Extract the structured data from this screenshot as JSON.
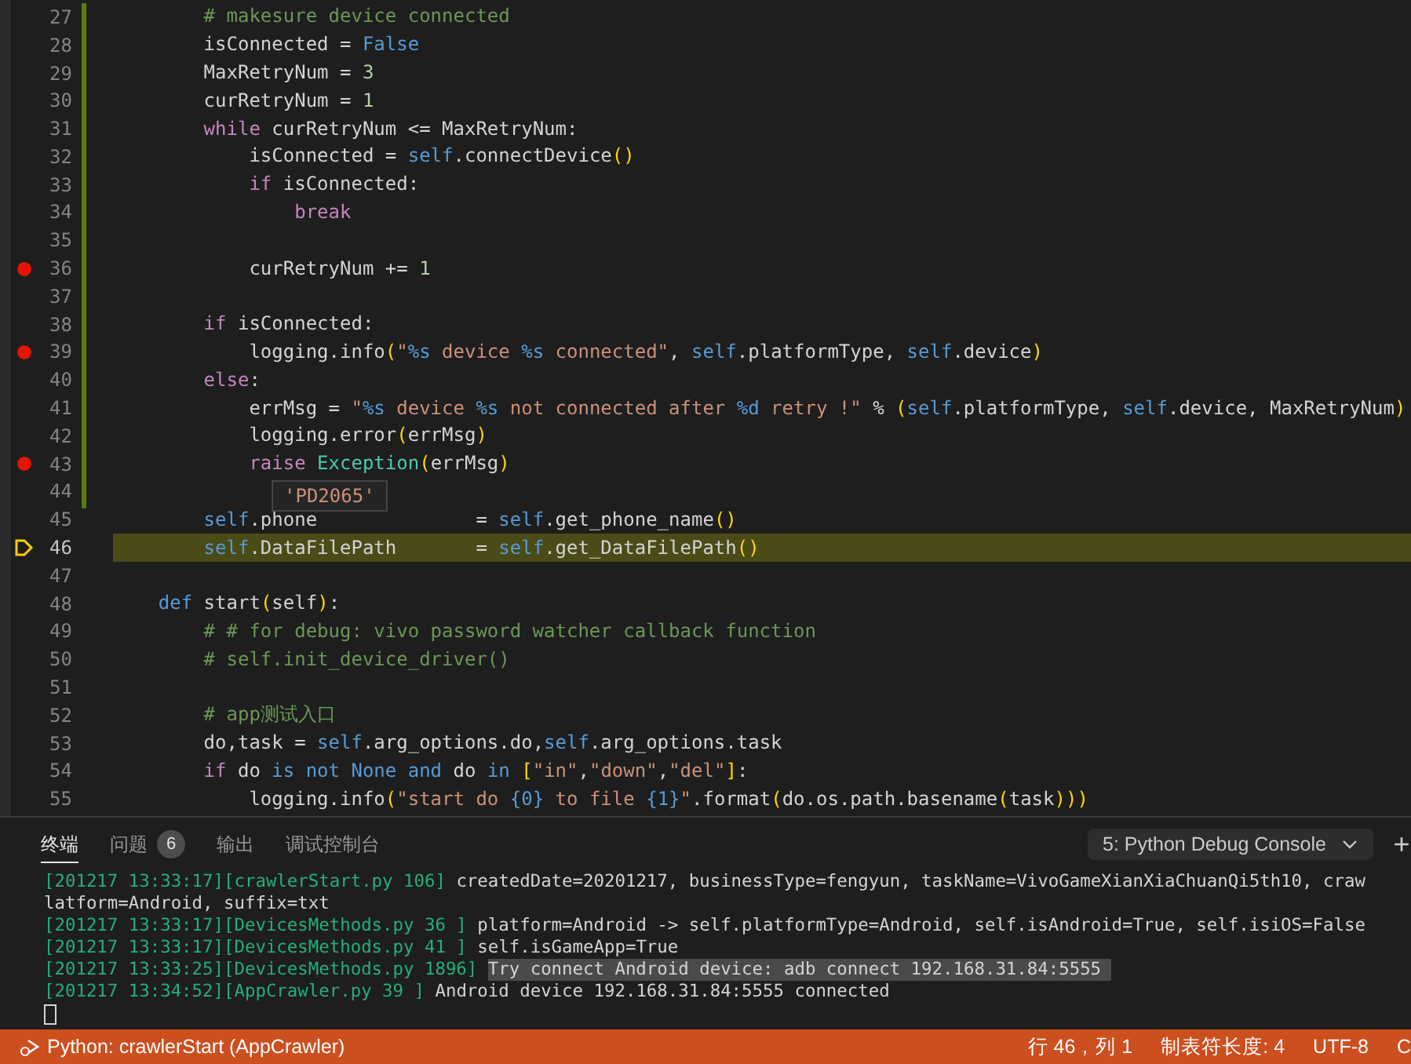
{
  "editor": {
    "lines": [
      {
        "number": "27",
        "breakpoint": false,
        "current": false,
        "tokens": [
          {
            "kind": "comment",
            "text": "        # makesure device connected"
          }
        ]
      },
      {
        "number": "28",
        "breakpoint": false,
        "current": false,
        "tokens": [
          {
            "kind": "plain",
            "text": "        isConnected = "
          },
          {
            "kind": "builtin",
            "text": "False"
          }
        ]
      },
      {
        "number": "29",
        "breakpoint": false,
        "current": false,
        "tokens": [
          {
            "kind": "plain",
            "text": "        MaxRetryNum = "
          },
          {
            "kind": "number",
            "text": "3"
          }
        ]
      },
      {
        "number": "30",
        "breakpoint": false,
        "current": false,
        "tokens": [
          {
            "kind": "plain",
            "text": "        curRetryNum = "
          },
          {
            "kind": "number",
            "text": "1"
          }
        ]
      },
      {
        "number": "31",
        "breakpoint": false,
        "current": false,
        "tokens": [
          {
            "kind": "keyword",
            "text": "        while"
          },
          {
            "kind": "plain",
            "text": " curRetryNum <= MaxRetryNum:"
          }
        ]
      },
      {
        "number": "32",
        "breakpoint": false,
        "current": false,
        "tokens": [
          {
            "kind": "plain",
            "text": "            isConnected = "
          },
          {
            "kind": "builtin",
            "text": "self"
          },
          {
            "kind": "plain",
            "text": ".connectDevice"
          },
          {
            "kind": "bracket",
            "text": "()"
          }
        ]
      },
      {
        "number": "33",
        "breakpoint": false,
        "current": false,
        "tokens": [
          {
            "kind": "keyword",
            "text": "            if"
          },
          {
            "kind": "plain",
            "text": " isConnected:"
          }
        ]
      },
      {
        "number": "34",
        "breakpoint": false,
        "current": false,
        "tokens": [
          {
            "kind": "keyword",
            "text": "                break"
          }
        ]
      },
      {
        "number": "35",
        "breakpoint": false,
        "current": false
      },
      {
        "number": "36",
        "breakpoint": true,
        "current": false,
        "tokens": [
          {
            "kind": "plain",
            "text": "            curRetryNum += "
          },
          {
            "kind": "number",
            "text": "1"
          }
        ]
      },
      {
        "number": "37",
        "breakpoint": false,
        "current": false
      },
      {
        "number": "38",
        "breakpoint": false,
        "current": false,
        "tokens": [
          {
            "kind": "keyword",
            "text": "        if"
          },
          {
            "kind": "plain",
            "text": " isConnected:"
          }
        ]
      },
      {
        "number": "39",
        "breakpoint": true,
        "current": false,
        "tokens": [
          {
            "kind": "plain",
            "text": "            logging.info"
          },
          {
            "kind": "bracket",
            "text": "("
          },
          {
            "kind": "string",
            "text": "\""
          },
          {
            "kind": "format",
            "text": "%s"
          },
          {
            "kind": "string",
            "text": " device "
          },
          {
            "kind": "format",
            "text": "%s"
          },
          {
            "kind": "string",
            "text": " connected\""
          },
          {
            "kind": "plain",
            "text": ", "
          },
          {
            "kind": "builtin",
            "text": "self"
          },
          {
            "kind": "plain",
            "text": ".platformType, "
          },
          {
            "kind": "builtin",
            "text": "self"
          },
          {
            "kind": "plain",
            "text": ".device"
          },
          {
            "kind": "bracket",
            "text": ")"
          }
        ]
      },
      {
        "number": "40",
        "breakpoint": false,
        "current": false,
        "tokens": [
          {
            "kind": "keyword",
            "text": "        else"
          },
          {
            "kind": "plain",
            "text": ":"
          }
        ]
      },
      {
        "number": "41",
        "breakpoint": false,
        "current": false,
        "tokens": [
          {
            "kind": "plain",
            "text": "            errMsg = "
          },
          {
            "kind": "string",
            "text": "\""
          },
          {
            "kind": "format",
            "text": "%s"
          },
          {
            "kind": "string",
            "text": " device "
          },
          {
            "kind": "format",
            "text": "%s"
          },
          {
            "kind": "string",
            "text": " not connected after "
          },
          {
            "kind": "format",
            "text": "%d"
          },
          {
            "kind": "string",
            "text": " retry !\""
          },
          {
            "kind": "plain",
            "text": " % "
          },
          {
            "kind": "bracket",
            "text": "("
          },
          {
            "kind": "builtin",
            "text": "self"
          },
          {
            "kind": "plain",
            "text": ".platformType, "
          },
          {
            "kind": "builtin",
            "text": "self"
          },
          {
            "kind": "plain",
            "text": ".device, MaxRetryNum"
          },
          {
            "kind": "bracket",
            "text": ")"
          }
        ]
      },
      {
        "number": "42",
        "breakpoint": false,
        "current": false,
        "tokens": [
          {
            "kind": "plain",
            "text": "            logging.error"
          },
          {
            "kind": "bracket",
            "text": "("
          },
          {
            "kind": "plain",
            "text": "errMsg"
          },
          {
            "kind": "bracket",
            "text": ")"
          }
        ]
      },
      {
        "number": "43",
        "breakpoint": true,
        "current": false,
        "tokens": [
          {
            "kind": "keyword",
            "text": "            raise"
          },
          {
            "kind": "type",
            "text": " Exception"
          },
          {
            "kind": "bracket",
            "text": "("
          },
          {
            "kind": "plain",
            "text": "errMsg"
          },
          {
            "kind": "bracket",
            "text": ")"
          }
        ]
      },
      {
        "number": "44",
        "breakpoint": false,
        "current": false
      },
      {
        "number": "45",
        "breakpoint": false,
        "current": false,
        "tokens": [
          {
            "kind": "builtin",
            "text": "        self"
          },
          {
            "kind": "plain",
            "text": ".phone              = "
          },
          {
            "kind": "builtin",
            "text": "self"
          },
          {
            "kind": "plain",
            "text": ".get_phone_name"
          },
          {
            "kind": "bracket",
            "text": "()"
          }
        ]
      },
      {
        "number": "46",
        "breakpoint": false,
        "current": true,
        "tokens": [
          {
            "kind": "builtin",
            "text": "        self"
          },
          {
            "kind": "plain",
            "text": ".DataFilePath       = "
          },
          {
            "kind": "builtin",
            "text": "self"
          },
          {
            "kind": "plain",
            "text": ".get_DataFilePath"
          },
          {
            "kind": "bracket",
            "text": "()"
          }
        ]
      },
      {
        "number": "47",
        "breakpoint": false,
        "current": false
      },
      {
        "number": "48",
        "breakpoint": false,
        "current": false,
        "tokens": [
          {
            "kind": "builtin",
            "text": "    def"
          },
          {
            "kind": "plain",
            "text": " start"
          },
          {
            "kind": "bracket",
            "text": "("
          },
          {
            "kind": "plain",
            "text": "self"
          },
          {
            "kind": "bracket",
            "text": ")"
          },
          {
            "kind": "plain",
            "text": ":"
          }
        ]
      },
      {
        "number": "49",
        "breakpoint": false,
        "current": false,
        "tokens": [
          {
            "kind": "comment",
            "text": "        # # for debug: vivo password watcher callback function"
          }
        ]
      },
      {
        "number": "50",
        "breakpoint": false,
        "current": false,
        "tokens": [
          {
            "kind": "comment",
            "text": "        # self.init_device_driver()"
          }
        ]
      },
      {
        "number": "51",
        "breakpoint": false,
        "current": false
      },
      {
        "number": "52",
        "breakpoint": false,
        "current": false,
        "tokens": [
          {
            "kind": "comment",
            "text": "        # app测试入口"
          }
        ]
      },
      {
        "number": "53",
        "breakpoint": false,
        "current": false,
        "tokens": [
          {
            "kind": "plain",
            "text": "        do,task = "
          },
          {
            "kind": "builtin",
            "text": "self"
          },
          {
            "kind": "plain",
            "text": ".arg_options.do,"
          },
          {
            "kind": "builtin",
            "text": "self"
          },
          {
            "kind": "plain",
            "text": ".arg_options.task"
          }
        ]
      },
      {
        "number": "54",
        "breakpoint": false,
        "current": false,
        "tokens": [
          {
            "kind": "keyword",
            "text": "        if"
          },
          {
            "kind": "plain",
            "text": " do "
          },
          {
            "kind": "builtin",
            "text": "is not None and"
          },
          {
            "kind": "plain",
            "text": " do "
          },
          {
            "kind": "builtin",
            "text": "in"
          },
          {
            "kind": "bracket",
            "text": " ["
          },
          {
            "kind": "string",
            "text": "\"in\""
          },
          {
            "kind": "plain",
            "text": ","
          },
          {
            "kind": "string",
            "text": "\"down\""
          },
          {
            "kind": "plain",
            "text": ","
          },
          {
            "kind": "string",
            "text": "\"del\""
          },
          {
            "kind": "bracket",
            "text": "]"
          },
          {
            "kind": "plain",
            "text": ":"
          }
        ]
      },
      {
        "number": "55",
        "breakpoint": false,
        "current": false,
        "tokens": [
          {
            "kind": "plain",
            "text": "            logging.info"
          },
          {
            "kind": "bracket",
            "text": "("
          },
          {
            "kind": "string",
            "text": "\"start do "
          },
          {
            "kind": "format",
            "text": "{0}"
          },
          {
            "kind": "string",
            "text": " to file "
          },
          {
            "kind": "format",
            "text": "{1}"
          },
          {
            "kind": "string",
            "text": "\""
          },
          {
            "kind": "plain",
            "text": ".format"
          },
          {
            "kind": "bracket",
            "text": "("
          },
          {
            "kind": "plain",
            "text": "do.os.path.basename"
          },
          {
            "kind": "bracket",
            "text": "("
          },
          {
            "kind": "plain",
            "text": "task"
          },
          {
            "kind": "bracket",
            "text": ")))"
          }
        ]
      }
    ],
    "hover_value": "'PD2065'"
  },
  "panel": {
    "tabs": [
      {
        "label": "终端",
        "selected": true
      },
      {
        "label": "问题",
        "selected": false,
        "badge": "6"
      },
      {
        "label": "输出",
        "selected": false
      },
      {
        "label": "调试控制台",
        "selected": false
      }
    ],
    "terminal_selector": "5: Python Debug Console",
    "add_button": "+",
    "lines": [
      {
        "prefix": "[201217 13:33:17][crawlerStart.py 106]",
        "text": " createdDate=20201217, businessType=fengyun, taskName=VivoGameXianXiaChuanQi5th10, craw"
      },
      {
        "text": "latform=Android, suffix=txt"
      },
      {
        "prefix": "[201217 13:33:17][DevicesMethods.py 36 ]",
        "text": " platform=Android -> self.platformType=Android, self.isAndroid=True, self.isiOS=False"
      },
      {
        "prefix": "[201217 13:33:17][DevicesMethods.py 41 ]",
        "text": " self.isGameApp=True"
      },
      {
        "prefix": "[201217 13:33:25][DevicesMethods.py 1896] ",
        "selected_text": "Try connect Android device: adb connect 192.168.31.84:5555 "
      },
      {
        "prefix": "[201217 13:34:52][AppCrawler.py 39 ]",
        "text": " Android device 192.168.31.84:5555 connected"
      }
    ]
  },
  "status_bar": {
    "left": "Python: crawlerStart (AppCrawler)",
    "right": [
      "行 46，列 1",
      "制表符长度: 4",
      "UTF-8",
      "C"
    ]
  }
}
